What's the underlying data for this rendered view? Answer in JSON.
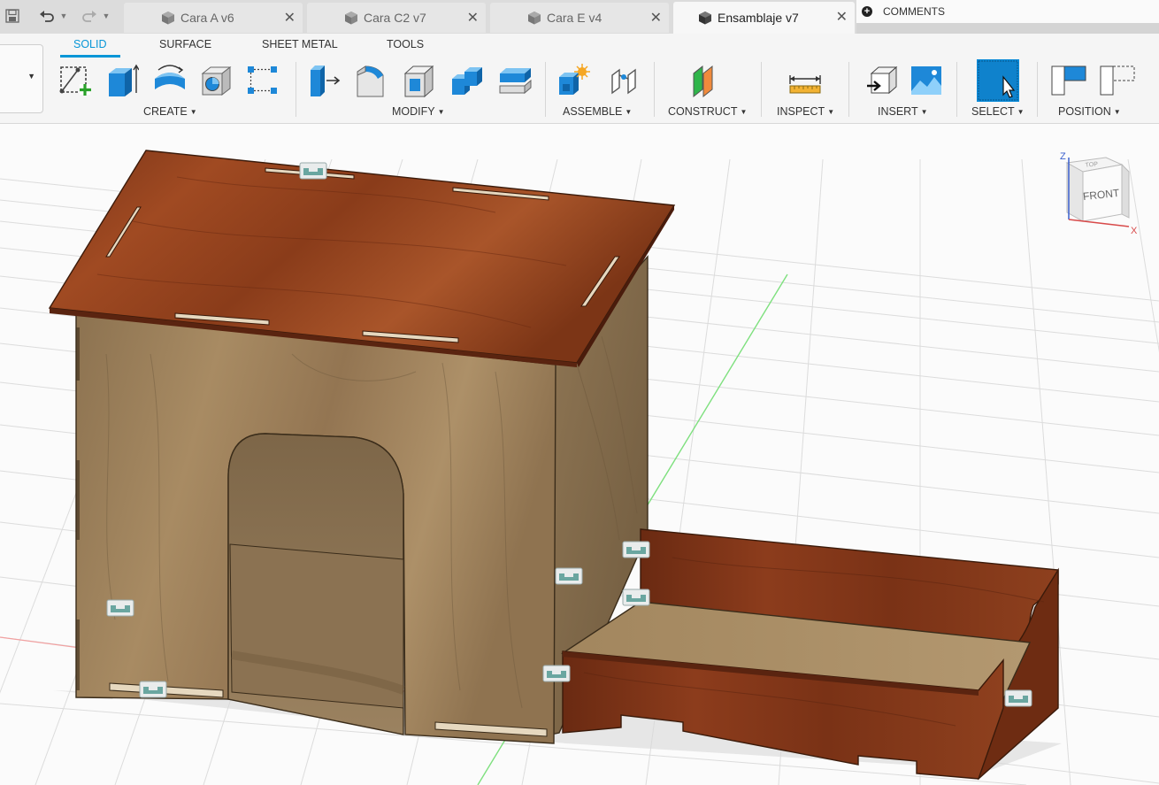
{
  "quick_access": {
    "save_icon": "save-icon",
    "undo_icon": "undo-icon",
    "redo_icon": "redo-icon"
  },
  "tabs": [
    {
      "label": "Cara A v6",
      "active": false
    },
    {
      "label": "Cara C2 v7",
      "active": false
    },
    {
      "label": "Cara E v4",
      "active": false
    },
    {
      "label": "Ensamblaje v7",
      "active": true
    }
  ],
  "comments_label": "COMMENTS",
  "ribbon": {
    "tabs": [
      "SOLID",
      "SURFACE",
      "SHEET METAL",
      "TOOLS"
    ],
    "active_tab": "SOLID",
    "groups": {
      "create": "CREATE",
      "modify": "MODIFY",
      "assemble": "ASSEMBLE",
      "construct": "CONSTRUCT",
      "inspect": "INSPECT",
      "insert": "INSERT",
      "select": "SELECT",
      "position": "POSITION"
    }
  },
  "viewcube": {
    "face": "FRONT",
    "top_face": "TOP",
    "axis_z": "Z",
    "axis_x": "X"
  },
  "colors": {
    "accent": "#0696d7",
    "plywood": "#a0845c",
    "mahogany": "#8a3a1c"
  }
}
